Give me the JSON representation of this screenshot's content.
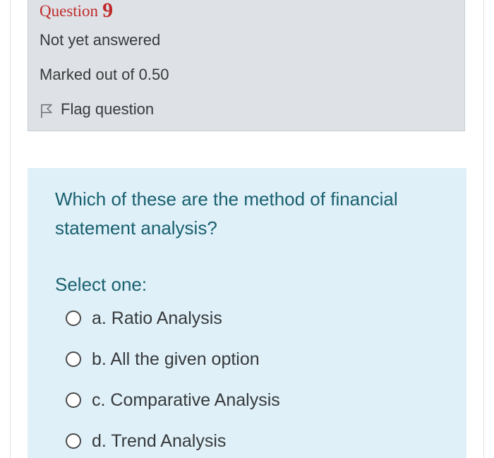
{
  "question_info": {
    "heading_prefix": "Question",
    "number": "9",
    "state": "Not yet answered",
    "grade": "Marked out of 0.50",
    "flag_label": "Flag question",
    "flag_icon": "flag-outline-icon"
  },
  "formulation": {
    "question_text": "Which of these are the method of financial statement analysis?",
    "prompt": "Select one:",
    "options": [
      {
        "label": "a. Ratio Analysis",
        "selected": false
      },
      {
        "label": "b. All the given option",
        "selected": false
      },
      {
        "label": "c. Comparative Analysis",
        "selected": false
      },
      {
        "label": "d. Trend Analysis",
        "selected": false
      }
    ]
  },
  "colors": {
    "heading": "#c12a2a",
    "info_background": "#dee2e6",
    "formulation_background": "#dff0f8",
    "question_text": "#19606f",
    "body_text": "#373a3c"
  }
}
